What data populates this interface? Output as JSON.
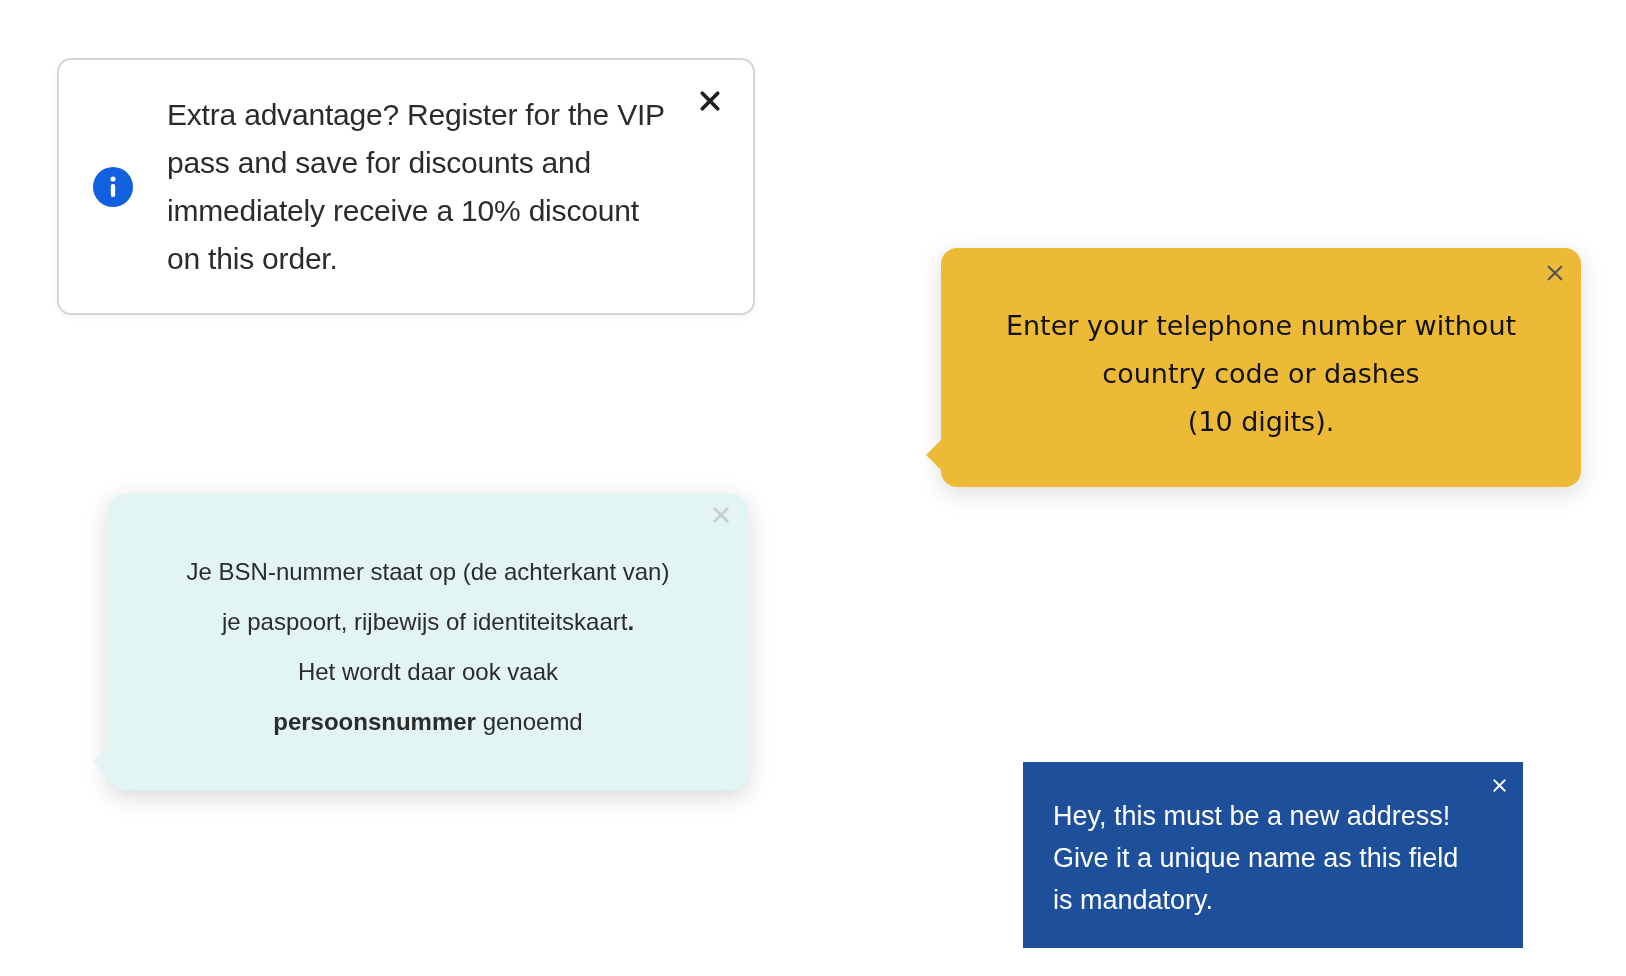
{
  "tooltips": [
    {
      "kind": "info",
      "lines": [
        "Extra advantage? Register for the VIP pass and save for discounts and immediately receive a 10% discount on this order."
      ]
    },
    {
      "kind": "hint",
      "lines": [
        "Je BSN-nummer staat op (de achterkant van)",
        "je paspoort, rijbewijs of identiteitskaart**.**",
        "Het wordt daar ook vaak",
        "**persoonsnummer** genoemd"
      ]
    },
    {
      "kind": "warning",
      "lines": [
        "Enter your telephone number without country code or dashes",
        "(10 digits)."
      ]
    },
    {
      "kind": "notice",
      "lines": [
        "Hey, this must be a new address!",
        "Give it a unique name as this field",
        "is mandatory."
      ]
    }
  ]
}
